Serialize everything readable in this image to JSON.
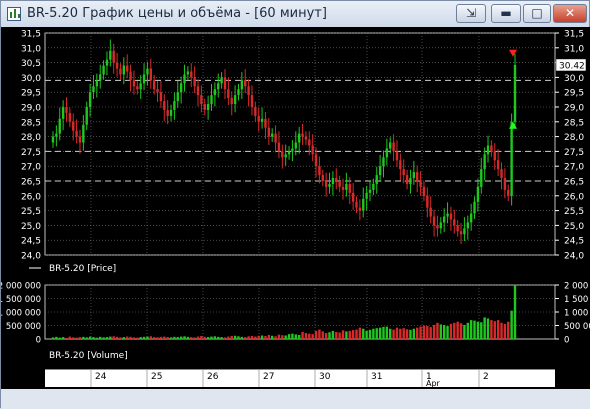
{
  "window": {
    "title": "BR-5.20 График цены и объёма - [60 минут]",
    "controls": {
      "restore": "⇲",
      "minimize": "▬",
      "maximize": "□",
      "close": "✕"
    }
  },
  "price_panel": {
    "legend": "BR-5.20 [Price]",
    "y_ticks": [
      "31,5",
      "31,0",
      "30,5",
      "30,0",
      "29,5",
      "29,0",
      "28,5",
      "28,0",
      "27,5",
      "27,0",
      "26,5",
      "26,0",
      "25,5",
      "25,0",
      "24,5",
      "24,0"
    ],
    "last_price_label": "30.42",
    "last_price": 30.42
  },
  "volume_panel": {
    "legend": "BR-5.20 [Volume]",
    "y_ticks_left": [
      "2 000 000",
      "1 500 000",
      "1 000 000",
      "500 000",
      "0"
    ],
    "y_ticks_right": [
      "2 000 000",
      "1 500 000",
      "1 000 000",
      "500 000",
      "0"
    ]
  },
  "time_axis": {
    "labels": [
      "24",
      "25",
      "26",
      "27",
      "30",
      "31",
      "1",
      "2"
    ],
    "month_label": "Apr"
  },
  "scroll": {
    "left": "◄",
    "right": "►",
    "grip": "|||"
  },
  "chart_data": {
    "type": "candlestick",
    "price_ylim": [
      24.0,
      31.5
    ],
    "volume_ylim": [
      0,
      2000000
    ],
    "dashed_levels": [
      29.9,
      27.5,
      26.5
    ],
    "markers": [
      {
        "kind": "sell",
        "price": 30.8,
        "color": "#ff2020"
      },
      {
        "kind": "buy",
        "price": 28.4,
        "color": "#20ff20"
      }
    ],
    "colors": {
      "up": "#1ec81e",
      "down": "#d82a2a",
      "background": "#000000",
      "grid": "#c8c8c8"
    },
    "closes": [
      28.0,
      28.1,
      28.6,
      29.0,
      28.8,
      28.5,
      28.2,
      28.0,
      27.8,
      28.4,
      29.0,
      29.5,
      29.7,
      29.9,
      30.1,
      30.4,
      30.6,
      30.9,
      30.5,
      30.3,
      30.1,
      30.4,
      30.2,
      29.9,
      29.7,
      29.6,
      29.8,
      30.1,
      30.3,
      29.9,
      29.6,
      29.5,
      29.2,
      28.9,
      28.7,
      28.9,
      29.2,
      29.5,
      29.8,
      30.1,
      30.2,
      30.0,
      29.7,
      29.4,
      29.1,
      28.9,
      29.1,
      29.4,
      29.6,
      29.8,
      30.0,
      29.6,
      29.3,
      29.1,
      29.4,
      29.6,
      29.9,
      29.7,
      29.4,
      29.0,
      28.7,
      28.5,
      28.6,
      28.3,
      28.0,
      28.1,
      27.8,
      27.5,
      27.3,
      27.4,
      27.5,
      27.6,
      27.8,
      28.1,
      28.0,
      27.9,
      27.7,
      27.4,
      27.0,
      26.7,
      26.5,
      26.3,
      26.4,
      26.6,
      26.5,
      26.3,
      26.2,
      26.4,
      26.1,
      25.8,
      25.6,
      25.5,
      25.9,
      26.1,
      26.2,
      26.4,
      26.7,
      27.0,
      27.3,
      27.6,
      27.8,
      27.5,
      27.2,
      26.9,
      26.7,
      26.4,
      26.6,
      26.8,
      26.5,
      26.3,
      26.0,
      25.6,
      25.3,
      25.0,
      24.9,
      25.1,
      25.3,
      25.4,
      25.2,
      25.0,
      24.8,
      24.7,
      24.9,
      25.1,
      25.4,
      25.8,
      26.3,
      26.9,
      27.4,
      27.7,
      27.5,
      27.2,
      26.9,
      26.6,
      26.2,
      26.0,
      28.5,
      30.42
    ],
    "volumes": [
      60000,
      80000,
      50000,
      70000,
      40000,
      90000,
      60000,
      50000,
      70000,
      80000,
      60000,
      90000,
      70000,
      50000,
      80000,
      60000,
      70000,
      90000,
      100000,
      80000,
      60000,
      70000,
      90000,
      80000,
      60000,
      50000,
      70000,
      80000,
      90000,
      100000,
      70000,
      60000,
      80000,
      90000,
      70000,
      60000,
      80000,
      70000,
      90000,
      100000,
      80000,
      70000,
      60000,
      90000,
      110000,
      80000,
      70000,
      90000,
      100000,
      80000,
      70000,
      60000,
      90000,
      110000,
      120000,
      100000,
      80000,
      70000,
      100000,
      110000,
      90000,
      120000,
      130000,
      110000,
      150000,
      120000,
      100000,
      160000,
      140000,
      130000,
      180000,
      200000,
      170000,
      150000,
      260000,
      220000,
      200000,
      180000,
      300000,
      350000,
      280000,
      220000,
      250000,
      300000,
      260000,
      240000,
      320000,
      280000,
      300000,
      330000,
      350000,
      420000,
      380000,
      300000,
      340000,
      380000,
      400000,
      420000,
      450000,
      460000,
      380000,
      350000,
      420000,
      380000,
      400000,
      360000,
      340000,
      380000,
      420000,
      460000,
      500000,
      480000,
      440000,
      520000,
      600000,
      540000,
      520000,
      480000,
      560000,
      600000,
      640000,
      580000,
      520000,
      600000,
      700000,
      680000,
      640000,
      620000,
      800000,
      760000,
      700000,
      660000,
      700000,
      600000,
      560000,
      640000,
      1050000,
      2000000
    ]
  }
}
